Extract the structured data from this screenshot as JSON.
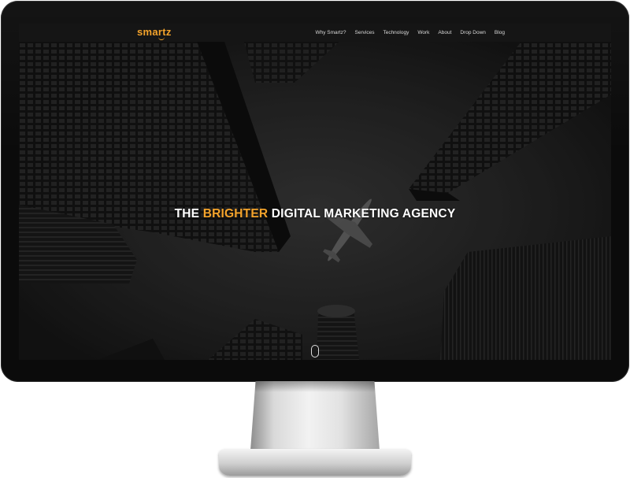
{
  "site": {
    "logo_text": "smartz",
    "brand_color": "#f4a32b"
  },
  "nav": {
    "items": [
      {
        "label": "Why Smartz?"
      },
      {
        "label": "Services"
      },
      {
        "label": "Technology"
      },
      {
        "label": "Work"
      },
      {
        "label": "About"
      },
      {
        "label": "Drop Down"
      },
      {
        "label": "Blog"
      }
    ]
  },
  "hero": {
    "headline_prefix": "THE ",
    "headline_accent": "BRIGHTER",
    "headline_suffix": " DIGITAL MARKETING AGENCY"
  },
  "icons": {
    "scroll": "mouse-scroll-icon"
  }
}
